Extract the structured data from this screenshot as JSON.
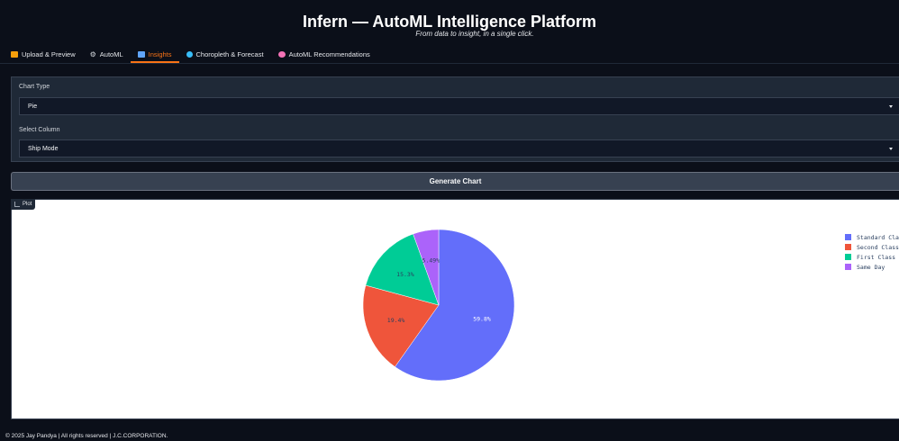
{
  "header": {
    "title": "Infern — AutoML Intelligence Platform",
    "subtitle": "From data to insight, in a single click."
  },
  "tabs": [
    {
      "label": "Upload & Preview",
      "icon": "folder-icon",
      "color": "#f59e0b"
    },
    {
      "label": "AutoML",
      "icon": "gear-icon",
      "color": "#d1d5db"
    },
    {
      "label": "Insights",
      "icon": "bar-chart-icon",
      "color": "#60a5fa",
      "active": true
    },
    {
      "label": "Choropleth & Forecast",
      "icon": "globe-icon",
      "color": "#38bdf8"
    },
    {
      "label": "AutoML Recommendations",
      "icon": "brain-icon",
      "color": "#f472b6"
    }
  ],
  "controls": {
    "chart_type_label": "Chart Type",
    "chart_type_value": "Pie",
    "column_label": "Select Column",
    "column_value": "Ship Mode",
    "generate_label": "Generate Chart"
  },
  "plot": {
    "label": "Plot"
  },
  "chart_data": {
    "type": "pie",
    "categories": [
      "Standard Clas",
      "Second Class",
      "First Class",
      "Same Day"
    ],
    "values": [
      59.8,
      19.4,
      15.3,
      5.49
    ],
    "value_labels": [
      "59.8%",
      "19.4%",
      "15.3%",
      "5.49%"
    ],
    "colors": [
      "#636efa",
      "#ef553b",
      "#00cc96",
      "#ab63fa"
    ],
    "legend_position": "right"
  },
  "footer": {
    "text": "© 2025 Jay Pandya | All rights reserved | J.C.CORPORATION."
  }
}
